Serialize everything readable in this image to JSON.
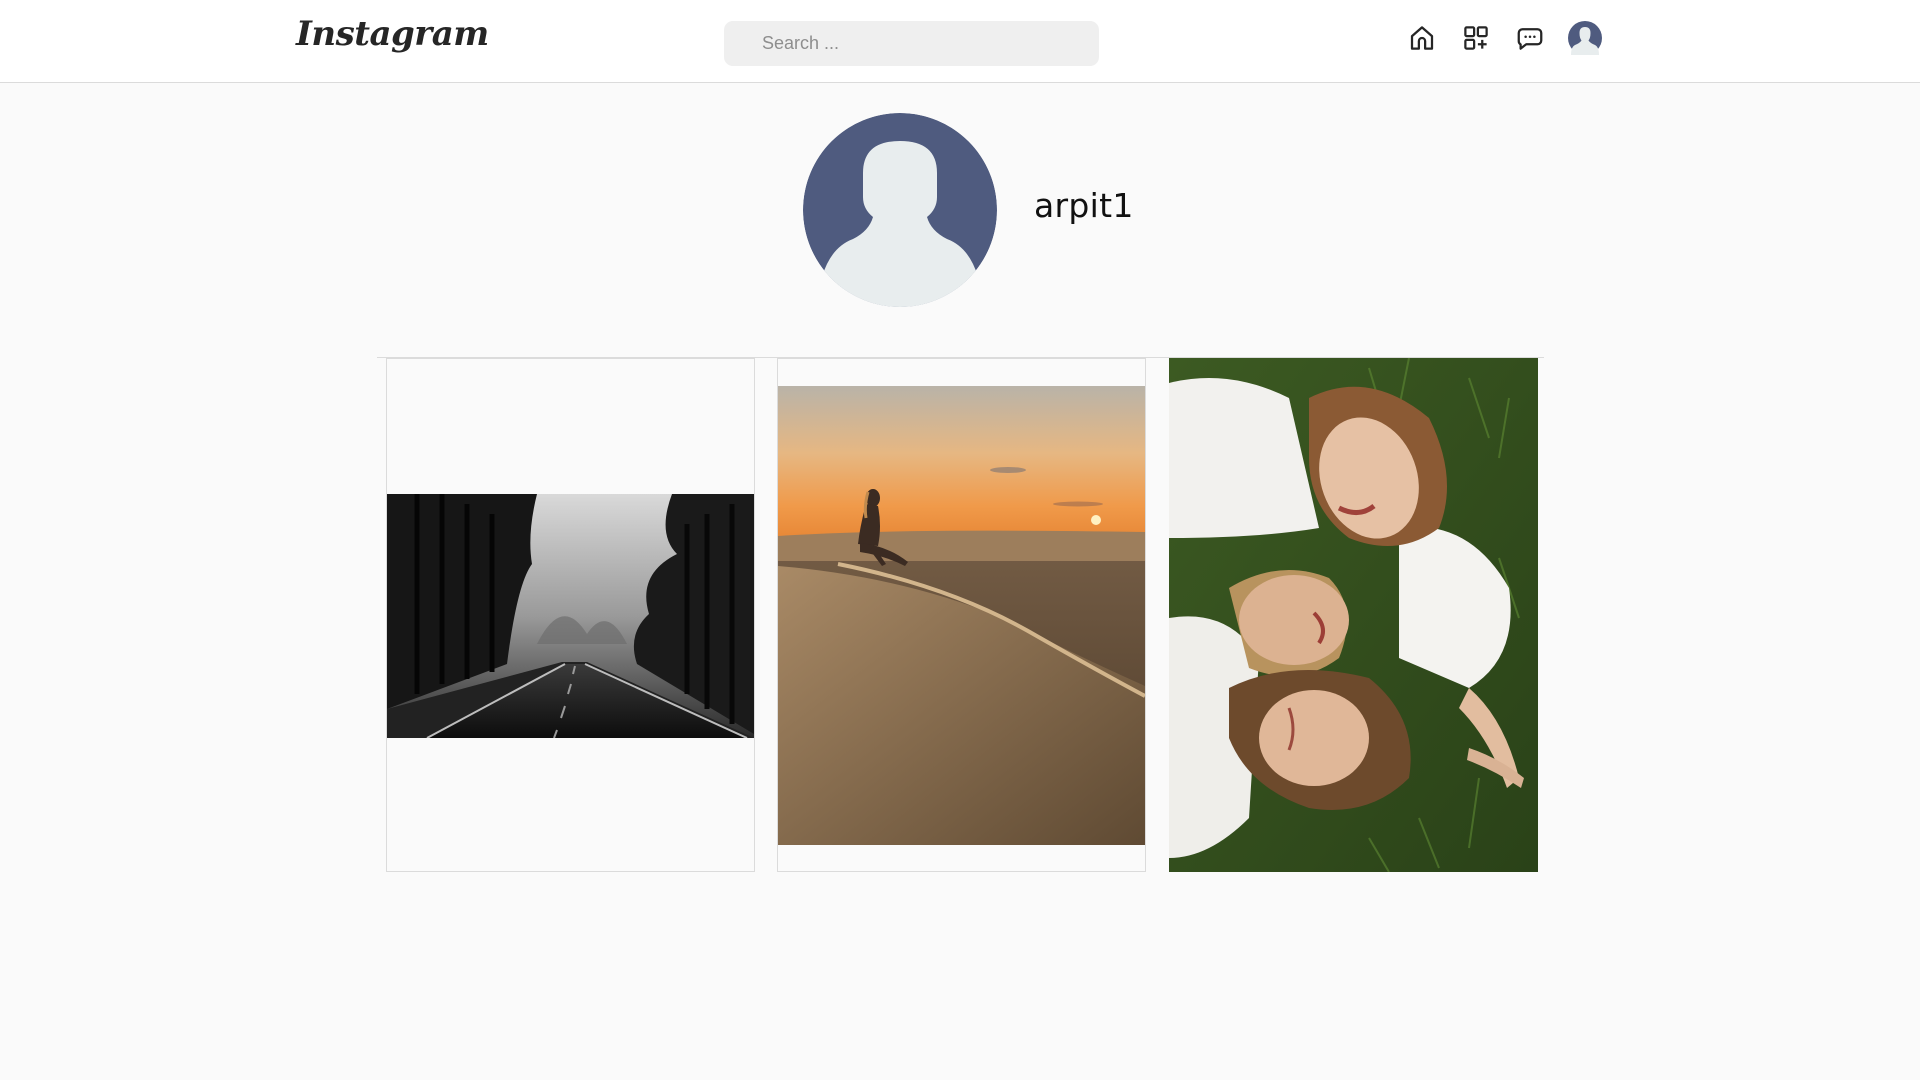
{
  "header": {
    "logo_text": "Instagram",
    "search": {
      "placeholder": "Search ...",
      "value": ""
    },
    "nav": [
      {
        "icon": "home-icon"
      },
      {
        "icon": "create-post-icon"
      },
      {
        "icon": "messages-icon"
      },
      {
        "icon": "profile-avatar-icon"
      }
    ]
  },
  "profile": {
    "username": "arpit1",
    "avatar": "default-avatar-icon"
  },
  "posts": [
    {
      "subject": "black-and-white forest road"
    },
    {
      "subject": "woman sitting on sand dune at sunset"
    },
    {
      "subject": "three women lying on grass"
    }
  ],
  "colors": {
    "header_bg": "#ffffff",
    "page_bg": "#fafafa",
    "border": "#dbdbdb",
    "search_bg": "#efefef",
    "avatar_bg": "#4f5b7f",
    "avatar_figure": "#e8edee"
  }
}
